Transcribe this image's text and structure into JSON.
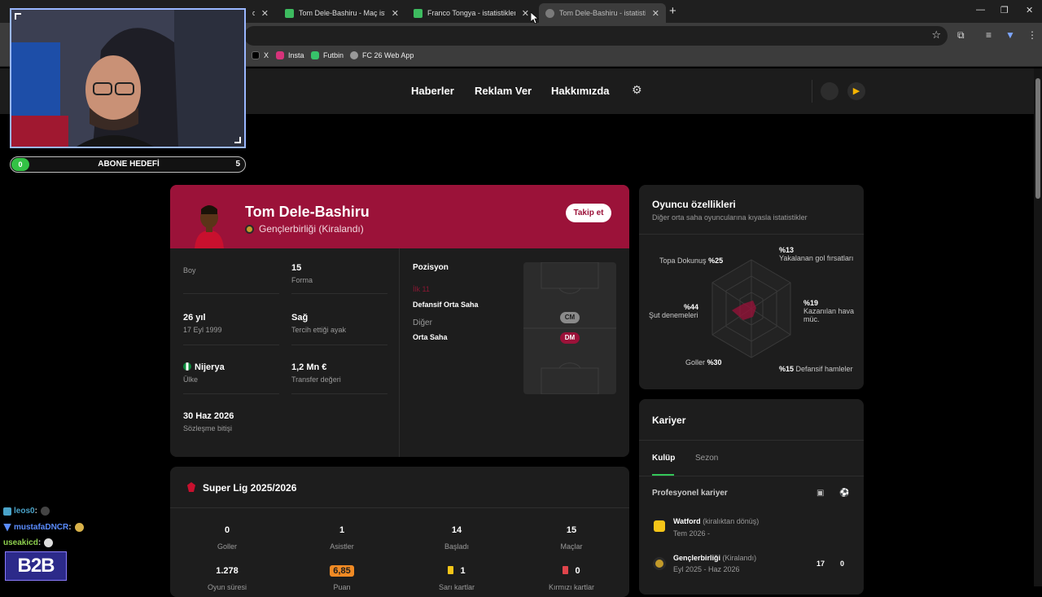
{
  "browser": {
    "tabs": [
      {
        "title": "ogl",
        "favicon_color": "#4d8ef7"
      },
      {
        "title": "Tom Dele-Bashiru - Maç istatistikleri",
        "favicon_color": "#3dbb5f"
      },
      {
        "title": "Franco Tongya - istatistikler, kariyer",
        "favicon_color": "#3dbb5f"
      },
      {
        "title": "Tom Dele-Bashiru - istatistikler",
        "favicon_color": "#7a7a7a"
      }
    ],
    "new_tab": "+",
    "bookmarks": [
      {
        "label": "X",
        "color": "#000000"
      },
      {
        "label": "Insta",
        "color": "#d6337a"
      },
      {
        "label": "Futbin",
        "color": "#37c26a"
      },
      {
        "label": "FC 26 Web App",
        "color": "#999999"
      }
    ]
  },
  "nav": {
    "links": [
      "Haberler",
      "Reklam Ver",
      "Hakkımızda"
    ]
  },
  "player": {
    "name": "Tom Dele-Bashiru",
    "club": "Gençlerbirliği (Kiralandı)",
    "follow_label": "Takip et",
    "attributes": [
      {
        "value": "Boy",
        "label": ""
      },
      {
        "value": "15",
        "label": "Forma"
      },
      {
        "value": "26 yıl",
        "label": "17 Eyl 1999"
      },
      {
        "value": "Sağ",
        "label": "Tercih ettiği ayak"
      },
      {
        "value": "Nijerya",
        "label": "Ülke"
      },
      {
        "value": "1,2 Mn €",
        "label": "Transfer değeri"
      },
      {
        "value": "30 Haz 2026",
        "label": "Sözleşme bitişi"
      }
    ],
    "position": {
      "title": "Pozisyon",
      "primary_label": "İlk 11",
      "primary": "Defansif Orta Saha",
      "other_label": "Diğer",
      "other": "Orta Saha",
      "chips": [
        "CM",
        "DM"
      ]
    },
    "accent": "#9b1239"
  },
  "traits": {
    "title": "Oyuncu özellikleri",
    "subtitle": "Diğer orta saha oyuncularına kıyasla istatistikler",
    "labels": [
      {
        "name": "Topa Dokunuş",
        "value": "%25"
      },
      {
        "name": "Yakalanan gol fırsatları",
        "value": "%13"
      },
      {
        "name": "Kazanılan hava müc.",
        "value": "%19"
      },
      {
        "name": "Defansif hamleler",
        "value": "%15"
      },
      {
        "name": "Goller",
        "value": "%30"
      },
      {
        "name": "Şut denemeleri",
        "value": "%44"
      }
    ]
  },
  "season": {
    "title": "Super Lig 2025/2026",
    "stats": [
      {
        "value": "0",
        "label": "Goller"
      },
      {
        "value": "1",
        "label": "Asistler"
      },
      {
        "value": "14",
        "label": "Başladı"
      },
      {
        "value": "15",
        "label": "Maçlar"
      },
      {
        "value": "1.278",
        "label": "Oyun süresi"
      },
      {
        "value": "6,85",
        "label": "Puan"
      },
      {
        "value": "1",
        "label": "Sarı kartlar"
      },
      {
        "value": "0",
        "label": "Kırmızı kartlar"
      }
    ]
  },
  "career": {
    "title": "Kariyer",
    "tabs": [
      "Kulüp",
      "Sezon"
    ],
    "section": "Profesyonel kariyer",
    "rows": [
      {
        "club": "Watford",
        "note": "(kiralıktan dönüş)",
        "date": "Tem 2026 -",
        "apps": "",
        "goals": ""
      },
      {
        "club": "Gençlerbirliği",
        "note": "(Kiralandı)",
        "date": "Eyl 2025 - Haz 2026",
        "apps": "17",
        "goals": "0"
      }
    ]
  },
  "stream": {
    "goal_title": "ABONE HEDEFİ",
    "goal_start": "0",
    "goal_end": "5",
    "chat": [
      {
        "user": "leos0",
        "color": "#4aa3c9"
      },
      {
        "user": "mustafaDNCR",
        "color": "#5a8cff"
      },
      {
        "user": "useakicd",
        "color": "#8fd14f"
      }
    ],
    "logo": "B2B"
  }
}
